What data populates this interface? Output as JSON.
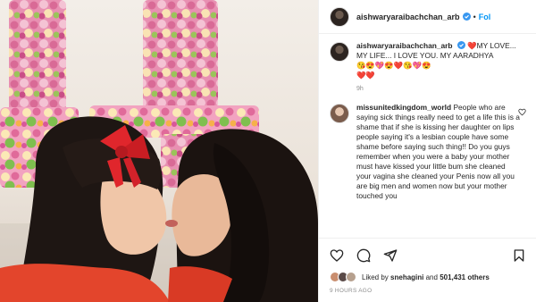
{
  "header": {
    "username": "aishwaryaraibachchan_arb",
    "separator": "•",
    "follow_label": "Fol"
  },
  "caption": {
    "username": "aishwaryaraibachchan_arb",
    "line1": "❤️MY LOVE... MY LIFE... I LOVE YOU. MY",
    "line2": "AARADHYA",
    "emoji_row": "😘😍💖😍❤️😘💖😍",
    "emoji_row2": "❤️❤️",
    "time": "9h"
  },
  "comment": {
    "username": "missunitedkingdom_world",
    "text": "People who are saying sick things really need to get a life this is a shame that if she is kissing her daughter on lips people saying it's a lesbian couple have some shame before saying such thing!! Do you guys remember when you were a baby your mother must have kissed your little bum she cleaned your vagina she cleaned your Penis now all you are big men and women now but your mother touched you"
  },
  "likes": {
    "prefix": "Liked by",
    "user": "snehagini",
    "connector": "and",
    "count": "501,431 others"
  },
  "timestamp": "9 HOURS AGO",
  "icons": [
    "verified-icon",
    "heart-icon",
    "comment-icon",
    "share-icon",
    "bookmark-icon"
  ],
  "colors": {
    "follow_blue": "#0095f6",
    "verified_blue": "#3897f0",
    "muted_gray": "#8e8e8e",
    "bow_red": "#e0262c"
  }
}
